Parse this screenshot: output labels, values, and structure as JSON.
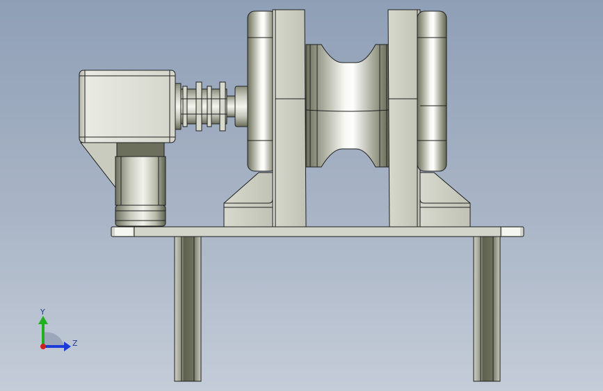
{
  "triad": {
    "y_label": "Y",
    "z_label": "Z",
    "colors": {
      "y": "#22b022",
      "z": "#1a3bd6",
      "x": "#d41d1d"
    }
  },
  "palette": {
    "metal_light": "#eceee5",
    "metal_mid": "#c7c9bd",
    "metal_dark": "#6f715f",
    "edge": "#1e1e1e"
  }
}
